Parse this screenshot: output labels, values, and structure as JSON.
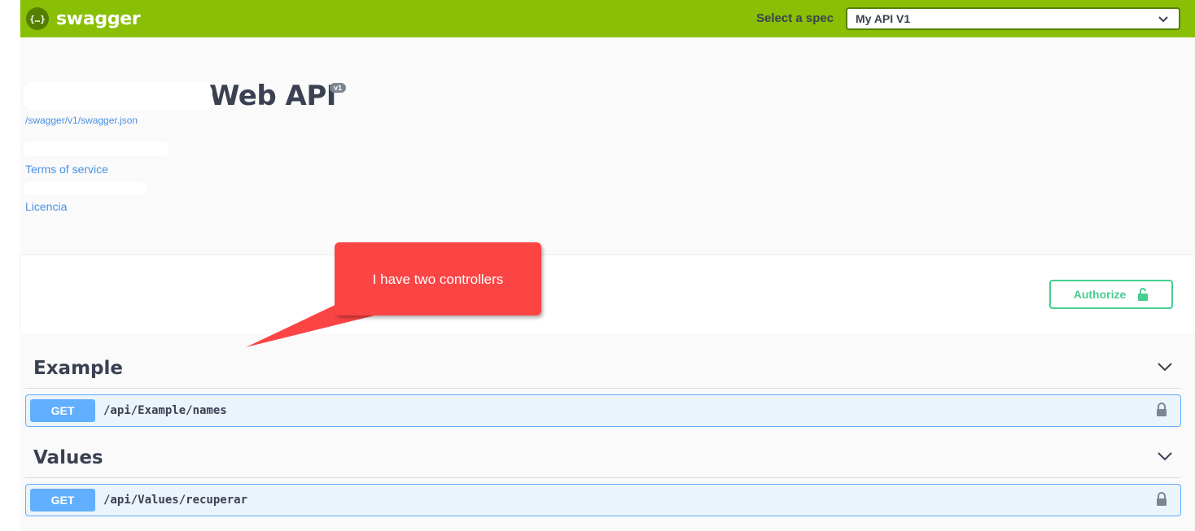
{
  "topbar": {
    "brand": "swagger",
    "logo_glyph": "{…}",
    "spec_label": "Select a spec",
    "spec_selected": "My API V1"
  },
  "info": {
    "title": "Web API",
    "version": "v1",
    "spec_url": "/swagger/v1/swagger.json",
    "terms_link": "Terms of service",
    "license_link": "Licencia"
  },
  "auth": {
    "authorize_label": "Authorize"
  },
  "annotation": {
    "text": "I have two controllers"
  },
  "tags": [
    {
      "name": "Example",
      "operations": [
        {
          "method": "GET",
          "path": "/api/Example/names"
        }
      ]
    },
    {
      "name": "Values",
      "operations": [
        {
          "method": "GET",
          "path": "/api/Values/recuperar"
        }
      ]
    }
  ],
  "colors": {
    "topbar": "#89bf04",
    "authorize": "#49cc90",
    "get": "#61affe",
    "callout": "#fb4444",
    "link": "#4990e2"
  }
}
